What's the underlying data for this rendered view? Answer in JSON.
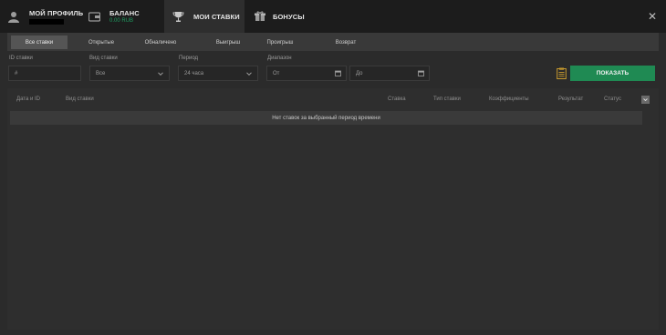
{
  "nav": {
    "profile": {
      "label": "МОЙ ПРОФИЛЬ",
      "icon": "user-icon"
    },
    "balance": {
      "label": "БАЛАНС",
      "sub": "0.00 RUB",
      "icon": "wallet-icon"
    },
    "bets": {
      "label": "МОИ СТАВКИ",
      "icon": "trophy-icon"
    },
    "bonuses": {
      "label": "БОНУСЫ",
      "icon": "gift-icon"
    },
    "close": "✕"
  },
  "tabs": [
    "Все ставки",
    "Открытые",
    "Обналичено",
    "Выигрыш",
    "Проигрыш",
    "Возврат"
  ],
  "filters": {
    "id_label": "ID ставки",
    "id_value": "#",
    "type_label": "Вид ставки",
    "type_value": "Все",
    "period_label": "Период",
    "period_value": "24 часа",
    "range_label": "Диапазон",
    "from_value": "От",
    "to_value": "До"
  },
  "show_button": "ПОКАЗАТЬ",
  "table": {
    "columns": [
      "Дата и ID",
      "Вид ставки",
      "Ставка",
      "Тип ставки",
      "Коэффициенты",
      "Результат",
      "Статус"
    ],
    "empty": "Нет ставок за выбранный период времени"
  },
  "colors": {
    "accent": "#1f8a53",
    "balance": "#1f9e62",
    "background": "#2b2b2b"
  }
}
